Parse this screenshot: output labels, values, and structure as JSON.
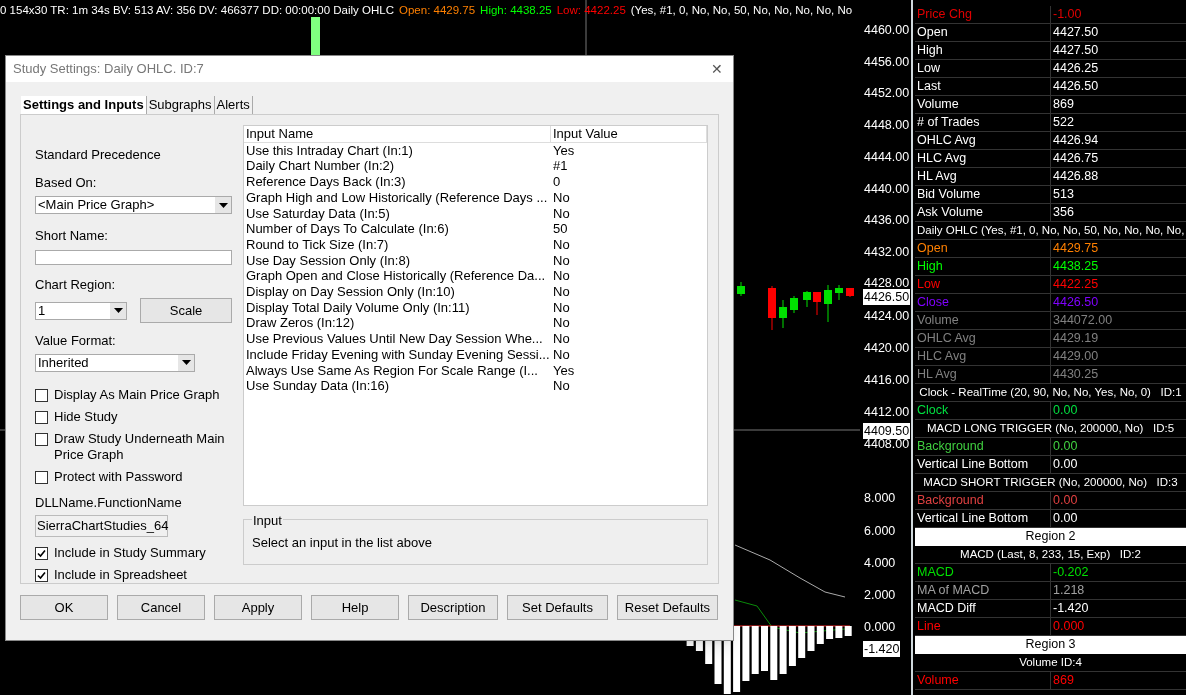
{
  "status_line": [
    {
      "text": "0 154x30 TR: 1m 34s BV: 513 AV: 356 DV: 466377 DD: 00:00:00 Daily OHLC",
      "color": "#ffffff"
    },
    {
      "text": "Open: 4429.75",
      "color": "#ff8000"
    },
    {
      "text": "High: 4438.25",
      "color": "#00ff00"
    },
    {
      "text": "Low: 4422.25",
      "color": "#ff0000"
    },
    {
      "text": "(Yes, #1, 0, No, No, 50, No, No, No, No, No",
      "color": "#ffffff"
    }
  ],
  "price_axis": [
    {
      "label": "4460.00",
      "highlighted": false
    },
    {
      "label": "4456.00",
      "highlighted": false
    },
    {
      "label": "4452.00",
      "highlighted": false
    },
    {
      "label": "4448.00",
      "highlighted": false
    },
    {
      "label": "4444.00",
      "highlighted": false
    },
    {
      "label": "4440.00",
      "highlighted": false
    },
    {
      "label": "4436.00",
      "highlighted": false
    },
    {
      "label": "4432.00",
      "highlighted": false
    },
    {
      "label": "4428.00",
      "highlighted": false
    },
    {
      "label": "4426.50",
      "highlighted": true
    },
    {
      "label": "4424.00",
      "highlighted": false
    },
    {
      "label": "4420.00",
      "highlighted": false
    },
    {
      "label": "4416.00",
      "highlighted": false
    },
    {
      "label": "4412.00",
      "highlighted": false
    },
    {
      "label": "4409.50",
      "highlighted": true
    },
    {
      "label": "4408.00",
      "highlighted": false
    },
    {
      "label": "8.000",
      "highlighted": false
    },
    {
      "label": "6.000",
      "highlighted": false
    },
    {
      "label": "4.000",
      "highlighted": false
    },
    {
      "label": "2.000",
      "highlighted": false
    },
    {
      "label": "0.000",
      "highlighted": false
    },
    {
      "label": "-1.420",
      "highlighted": true
    }
  ],
  "data_panel": [
    {
      "kind": "row",
      "label": "Price Chg",
      "value": "-1.00",
      "color": "#e00000"
    },
    {
      "kind": "row",
      "label": "Open",
      "value": "4427.50",
      "color": "#ffffff"
    },
    {
      "kind": "row",
      "label": "High",
      "value": "4427.50",
      "color": "#ffffff"
    },
    {
      "kind": "row",
      "label": "Low",
      "value": "4426.25",
      "color": "#ffffff"
    },
    {
      "kind": "row",
      "label": "Last",
      "value": "4426.50",
      "color": "#ffffff"
    },
    {
      "kind": "row",
      "label": "Volume",
      "value": "869",
      "color": "#ffffff"
    },
    {
      "kind": "row",
      "label": "# of Trades",
      "value": "522",
      "color": "#ffffff"
    },
    {
      "kind": "row",
      "label": "OHLC Avg",
      "value": "4426.94",
      "color": "#ffffff"
    },
    {
      "kind": "row",
      "label": "HLC Avg",
      "value": "4426.75",
      "color": "#ffffff"
    },
    {
      "kind": "row",
      "label": "HL Avg",
      "value": "4426.88",
      "color": "#ffffff"
    },
    {
      "kind": "row",
      "label": "Bid Volume",
      "value": "513",
      "color": "#ffffff"
    },
    {
      "kind": "row",
      "label": "Ask Volume",
      "value": "356",
      "color": "#ffffff"
    },
    {
      "kind": "study",
      "text": "Daily OHLC (Yes, #1, 0, No, No, 50, No, No, No, No,"
    },
    {
      "kind": "row",
      "label": "Open",
      "value": "4429.75",
      "color": "#ff8000"
    },
    {
      "kind": "row",
      "label": "High",
      "value": "4438.25",
      "color": "#00ff00"
    },
    {
      "kind": "row",
      "label": "Low",
      "value": "4422.25",
      "color": "#ff0000"
    },
    {
      "kind": "row",
      "label": "Close",
      "value": "4426.50",
      "color": "#8000ff"
    },
    {
      "kind": "row",
      "label": "Volume",
      "value": "344072.00",
      "color": "#808080"
    },
    {
      "kind": "row",
      "label": "OHLC Avg",
      "value": "4429.19",
      "color": "#808080"
    },
    {
      "kind": "row",
      "label": "HLC Avg",
      "value": "4429.00",
      "color": "#808080"
    },
    {
      "kind": "row",
      "label": "HL Avg",
      "value": "4430.25",
      "color": "#808080"
    },
    {
      "kind": "header",
      "text": "Clock - RealTime (20, 90, No, No, Yes, No, 0)   ID:1"
    },
    {
      "kind": "row",
      "label": "Clock",
      "value": "0.00",
      "color": "#00e040"
    },
    {
      "kind": "header",
      "text": "MACD LONG TRIGGER (No, 200000, No)   ID:5"
    },
    {
      "kind": "row",
      "label": "Background",
      "value": "0.00",
      "color": "#40d040"
    },
    {
      "kind": "row",
      "label": "Vertical Line Bottom",
      "value": "0.00",
      "color": "#ffffff"
    },
    {
      "kind": "header",
      "text": "MACD SHORT TRIGGER (No, 200000, No)   ID:3"
    },
    {
      "kind": "row",
      "label": "Background",
      "value": "0.00",
      "color": "#e04040"
    },
    {
      "kind": "row",
      "label": "Vertical Line Bottom",
      "value": "0.00",
      "color": "#ffffff"
    },
    {
      "kind": "region",
      "text": "Region 2"
    },
    {
      "kind": "header",
      "text": "MACD (Last, 8, 233, 15, Exp)   ID:2"
    },
    {
      "kind": "row",
      "label": "MACD",
      "value": "-0.202",
      "color": "#00e000"
    },
    {
      "kind": "row",
      "label": "MA of MACD",
      "value": "1.218",
      "color": "#a0a0a0"
    },
    {
      "kind": "row",
      "label": "MACD Diff",
      "value": "-1.420",
      "color": "#ffffff"
    },
    {
      "kind": "row",
      "label": "Line",
      "value": "0.000",
      "color": "#ff0000"
    },
    {
      "kind": "region",
      "text": "Region 3"
    },
    {
      "kind": "header",
      "text": "Volume ID:4"
    },
    {
      "kind": "row",
      "label": "Volume",
      "value": "869",
      "color": "#ff0000"
    }
  ],
  "dialog": {
    "title": "Study Settings: Daily OHLC. ID:7",
    "close": "✕",
    "tabs": [
      {
        "label": "Settings and Inputs",
        "selected": true
      },
      {
        "label": "Subgraphs",
        "selected": false
      },
      {
        "label": "Alerts",
        "selected": false
      }
    ],
    "precedence": "Standard Precedence",
    "based_on": {
      "label": "Based On:",
      "value": "<Main Price Graph>"
    },
    "short_name": {
      "label": "Short Name:"
    },
    "chart_region": {
      "label": "Chart Region:",
      "value": "1",
      "button": "Scale"
    },
    "value_format": {
      "label": "Value Format:",
      "value": "Inherited"
    },
    "checkboxes": [
      {
        "label": "Display As Main Price Graph",
        "checked": false
      },
      {
        "label": "Hide Study",
        "checked": false
      },
      {
        "label": "Draw Study Underneath Main Price Graph",
        "checked": false
      },
      {
        "label": "Protect with Password",
        "checked": false
      }
    ],
    "dll": {
      "label": "DLLName.FunctionName",
      "value": "SierraChartStudies_64"
    },
    "checkboxes_2": [
      {
        "label": "Include in Study Summary",
        "checked": true
      },
      {
        "label": "Include in Spreadsheet",
        "checked": true
      }
    ],
    "inputs": {
      "columns": [
        "Input Name",
        "Input Value"
      ],
      "rows": [
        [
          "Use this Intraday Chart  (In:1)",
          "Yes"
        ],
        [
          "Daily Chart Number  (In:2)",
          "#1"
        ],
        [
          "Reference Days Back  (In:3)",
          "0"
        ],
        [
          "Graph High and Low Historically (Reference Days ...",
          "No"
        ],
        [
          "Use Saturday Data  (In:5)",
          "No"
        ],
        [
          "Number of Days To Calculate  (In:6)",
          "50"
        ],
        [
          "Round to Tick Size  (In:7)",
          "No"
        ],
        [
          "Use Day Session Only  (In:8)",
          "No"
        ],
        [
          "Graph Open and Close Historically (Reference Da...",
          "No"
        ],
        [
          "Display on Day Session Only  (In:10)",
          "No"
        ],
        [
          "Display Total Daily Volume Only  (In:11)",
          "No"
        ],
        [
          "Draw Zeros  (In:12)",
          "No"
        ],
        [
          "Use Previous Values Until New Day Session Whe...",
          "No"
        ],
        [
          "Include Friday Evening with Sunday Evening Sessi...",
          "No"
        ],
        [
          "Always Use Same As Region For Scale Range  (I...",
          "Yes"
        ],
        [
          "Use Sunday Data  (In:16)",
          "No"
        ]
      ]
    },
    "input_group": {
      "label": "Input",
      "text": "Select an input in the list above"
    },
    "buttons": [
      "OK",
      "Cancel",
      "Apply",
      "Help",
      "Description",
      "Set Defaults",
      "Reset Defaults"
    ]
  }
}
